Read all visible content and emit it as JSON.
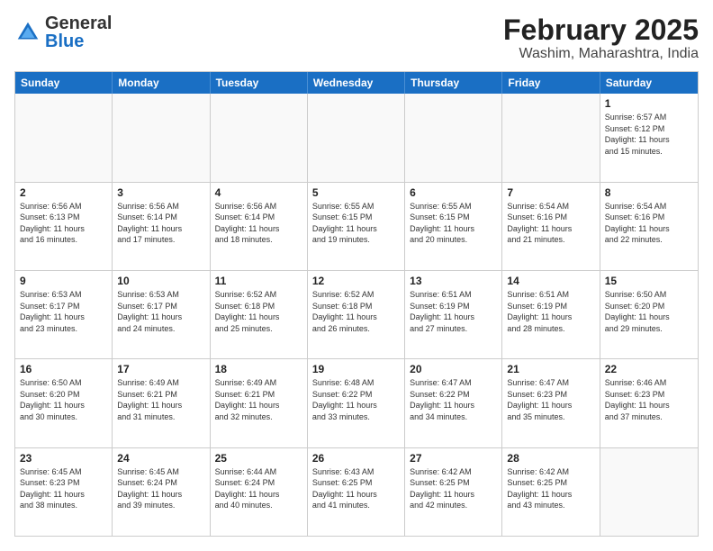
{
  "header": {
    "logo": {
      "general": "General",
      "blue": "Blue"
    },
    "title": "February 2025",
    "location": "Washim, Maharashtra, India"
  },
  "weekdays": [
    "Sunday",
    "Monday",
    "Tuesday",
    "Wednesday",
    "Thursday",
    "Friday",
    "Saturday"
  ],
  "rows": [
    {
      "cells": [
        {
          "day": "",
          "info": "",
          "empty": true
        },
        {
          "day": "",
          "info": "",
          "empty": true
        },
        {
          "day": "",
          "info": "",
          "empty": true
        },
        {
          "day": "",
          "info": "",
          "empty": true
        },
        {
          "day": "",
          "info": "",
          "empty": true
        },
        {
          "day": "",
          "info": "",
          "empty": true
        },
        {
          "day": "1",
          "info": "Sunrise: 6:57 AM\nSunset: 6:12 PM\nDaylight: 11 hours\nand 15 minutes."
        }
      ]
    },
    {
      "cells": [
        {
          "day": "2",
          "info": "Sunrise: 6:56 AM\nSunset: 6:13 PM\nDaylight: 11 hours\nand 16 minutes."
        },
        {
          "day": "3",
          "info": "Sunrise: 6:56 AM\nSunset: 6:14 PM\nDaylight: 11 hours\nand 17 minutes."
        },
        {
          "day": "4",
          "info": "Sunrise: 6:56 AM\nSunset: 6:14 PM\nDaylight: 11 hours\nand 18 minutes."
        },
        {
          "day": "5",
          "info": "Sunrise: 6:55 AM\nSunset: 6:15 PM\nDaylight: 11 hours\nand 19 minutes."
        },
        {
          "day": "6",
          "info": "Sunrise: 6:55 AM\nSunset: 6:15 PM\nDaylight: 11 hours\nand 20 minutes."
        },
        {
          "day": "7",
          "info": "Sunrise: 6:54 AM\nSunset: 6:16 PM\nDaylight: 11 hours\nand 21 minutes."
        },
        {
          "day": "8",
          "info": "Sunrise: 6:54 AM\nSunset: 6:16 PM\nDaylight: 11 hours\nand 22 minutes."
        }
      ]
    },
    {
      "cells": [
        {
          "day": "9",
          "info": "Sunrise: 6:53 AM\nSunset: 6:17 PM\nDaylight: 11 hours\nand 23 minutes."
        },
        {
          "day": "10",
          "info": "Sunrise: 6:53 AM\nSunset: 6:17 PM\nDaylight: 11 hours\nand 24 minutes."
        },
        {
          "day": "11",
          "info": "Sunrise: 6:52 AM\nSunset: 6:18 PM\nDaylight: 11 hours\nand 25 minutes."
        },
        {
          "day": "12",
          "info": "Sunrise: 6:52 AM\nSunset: 6:18 PM\nDaylight: 11 hours\nand 26 minutes."
        },
        {
          "day": "13",
          "info": "Sunrise: 6:51 AM\nSunset: 6:19 PM\nDaylight: 11 hours\nand 27 minutes."
        },
        {
          "day": "14",
          "info": "Sunrise: 6:51 AM\nSunset: 6:19 PM\nDaylight: 11 hours\nand 28 minutes."
        },
        {
          "day": "15",
          "info": "Sunrise: 6:50 AM\nSunset: 6:20 PM\nDaylight: 11 hours\nand 29 minutes."
        }
      ]
    },
    {
      "cells": [
        {
          "day": "16",
          "info": "Sunrise: 6:50 AM\nSunset: 6:20 PM\nDaylight: 11 hours\nand 30 minutes."
        },
        {
          "day": "17",
          "info": "Sunrise: 6:49 AM\nSunset: 6:21 PM\nDaylight: 11 hours\nand 31 minutes."
        },
        {
          "day": "18",
          "info": "Sunrise: 6:49 AM\nSunset: 6:21 PM\nDaylight: 11 hours\nand 32 minutes."
        },
        {
          "day": "19",
          "info": "Sunrise: 6:48 AM\nSunset: 6:22 PM\nDaylight: 11 hours\nand 33 minutes."
        },
        {
          "day": "20",
          "info": "Sunrise: 6:47 AM\nSunset: 6:22 PM\nDaylight: 11 hours\nand 34 minutes."
        },
        {
          "day": "21",
          "info": "Sunrise: 6:47 AM\nSunset: 6:23 PM\nDaylight: 11 hours\nand 35 minutes."
        },
        {
          "day": "22",
          "info": "Sunrise: 6:46 AM\nSunset: 6:23 PM\nDaylight: 11 hours\nand 37 minutes."
        }
      ]
    },
    {
      "cells": [
        {
          "day": "23",
          "info": "Sunrise: 6:45 AM\nSunset: 6:23 PM\nDaylight: 11 hours\nand 38 minutes."
        },
        {
          "day": "24",
          "info": "Sunrise: 6:45 AM\nSunset: 6:24 PM\nDaylight: 11 hours\nand 39 minutes."
        },
        {
          "day": "25",
          "info": "Sunrise: 6:44 AM\nSunset: 6:24 PM\nDaylight: 11 hours\nand 40 minutes."
        },
        {
          "day": "26",
          "info": "Sunrise: 6:43 AM\nSunset: 6:25 PM\nDaylight: 11 hours\nand 41 minutes."
        },
        {
          "day": "27",
          "info": "Sunrise: 6:42 AM\nSunset: 6:25 PM\nDaylight: 11 hours\nand 42 minutes."
        },
        {
          "day": "28",
          "info": "Sunrise: 6:42 AM\nSunset: 6:25 PM\nDaylight: 11 hours\nand 43 minutes."
        },
        {
          "day": "",
          "info": "",
          "empty": true
        }
      ]
    }
  ]
}
